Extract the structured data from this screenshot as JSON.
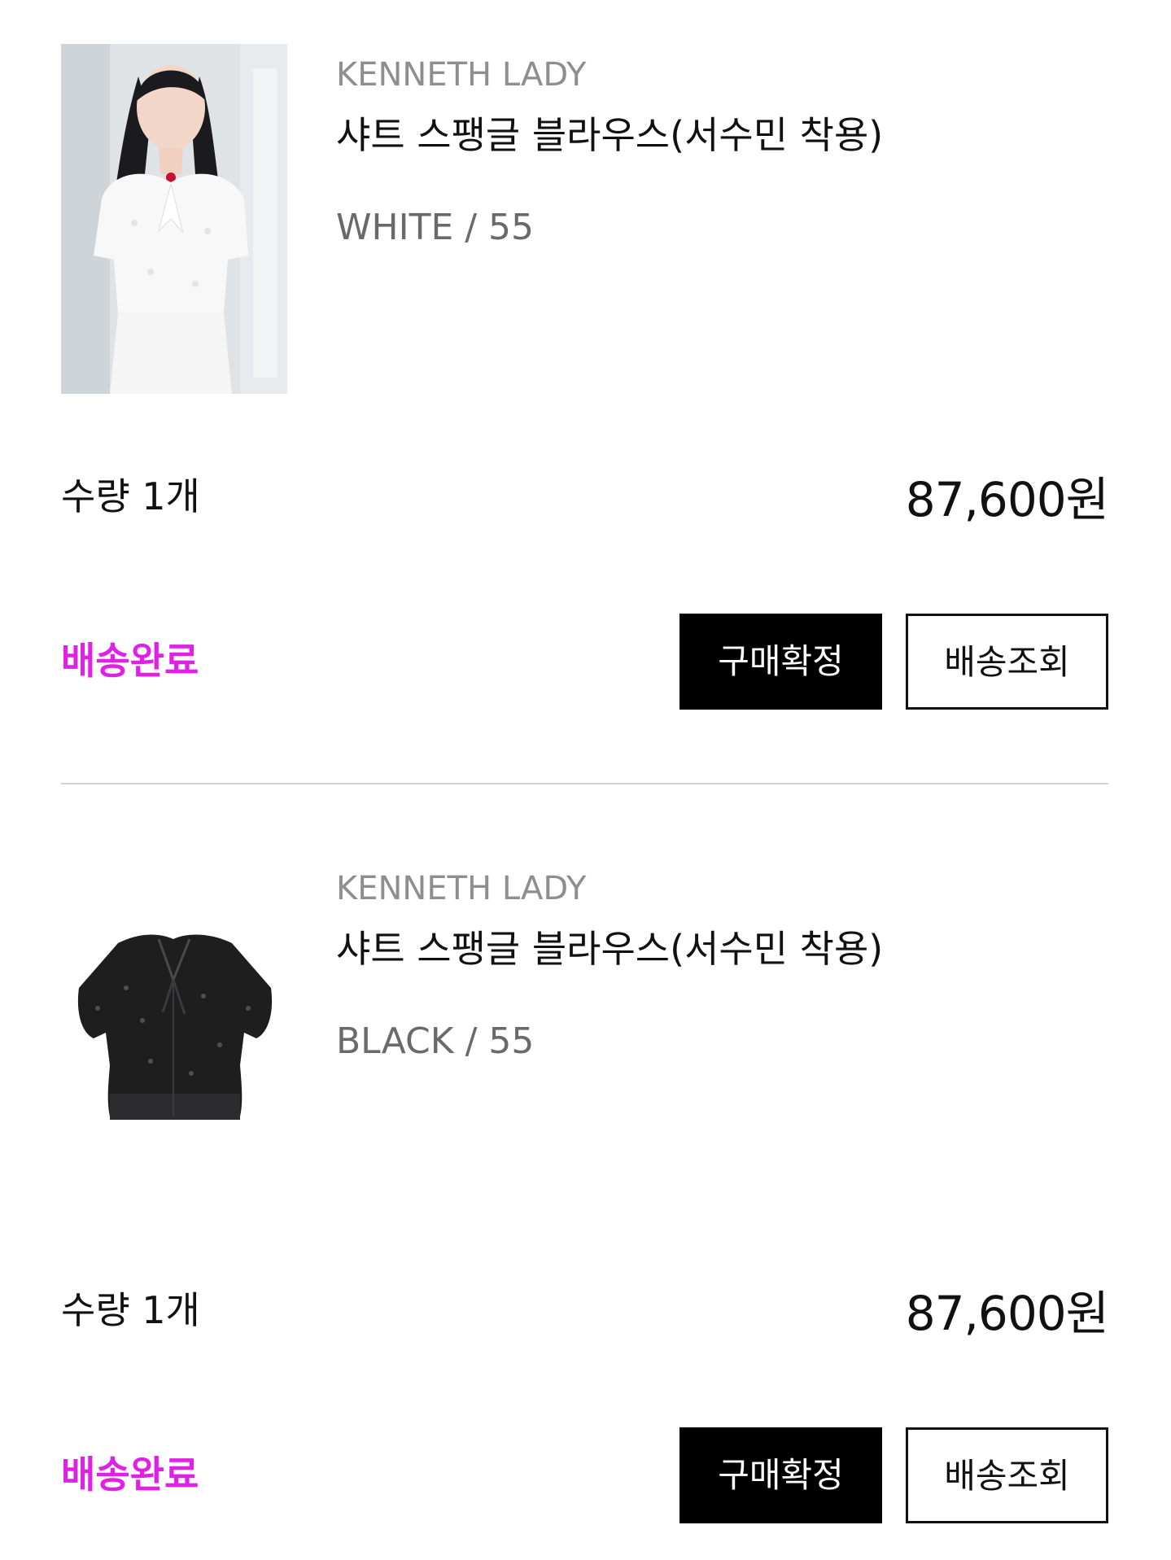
{
  "orders": [
    {
      "brand": "KENNETH LADY",
      "product_name": "샤트 스팽글 블라우스(서수민 착용)",
      "option": "WHITE / 55",
      "quantity": "수량 1개",
      "price": "87,600원",
      "status": "배송완료",
      "confirm_label": "구매확정",
      "track_label": "배송조회"
    },
    {
      "brand": "KENNETH LADY",
      "product_name": "샤트 스팽글 블라우스(서수민 착용)",
      "option": "BLACK / 55",
      "quantity": "수량 1개",
      "price": "87,600원",
      "status": "배송완료",
      "confirm_label": "구매확정",
      "track_label": "배송조회"
    }
  ],
  "colors": {
    "status": "#e020e6",
    "brand_text": "#8e8e8e",
    "option_text": "#6a6a6a",
    "divider": "#d2d2d2"
  }
}
